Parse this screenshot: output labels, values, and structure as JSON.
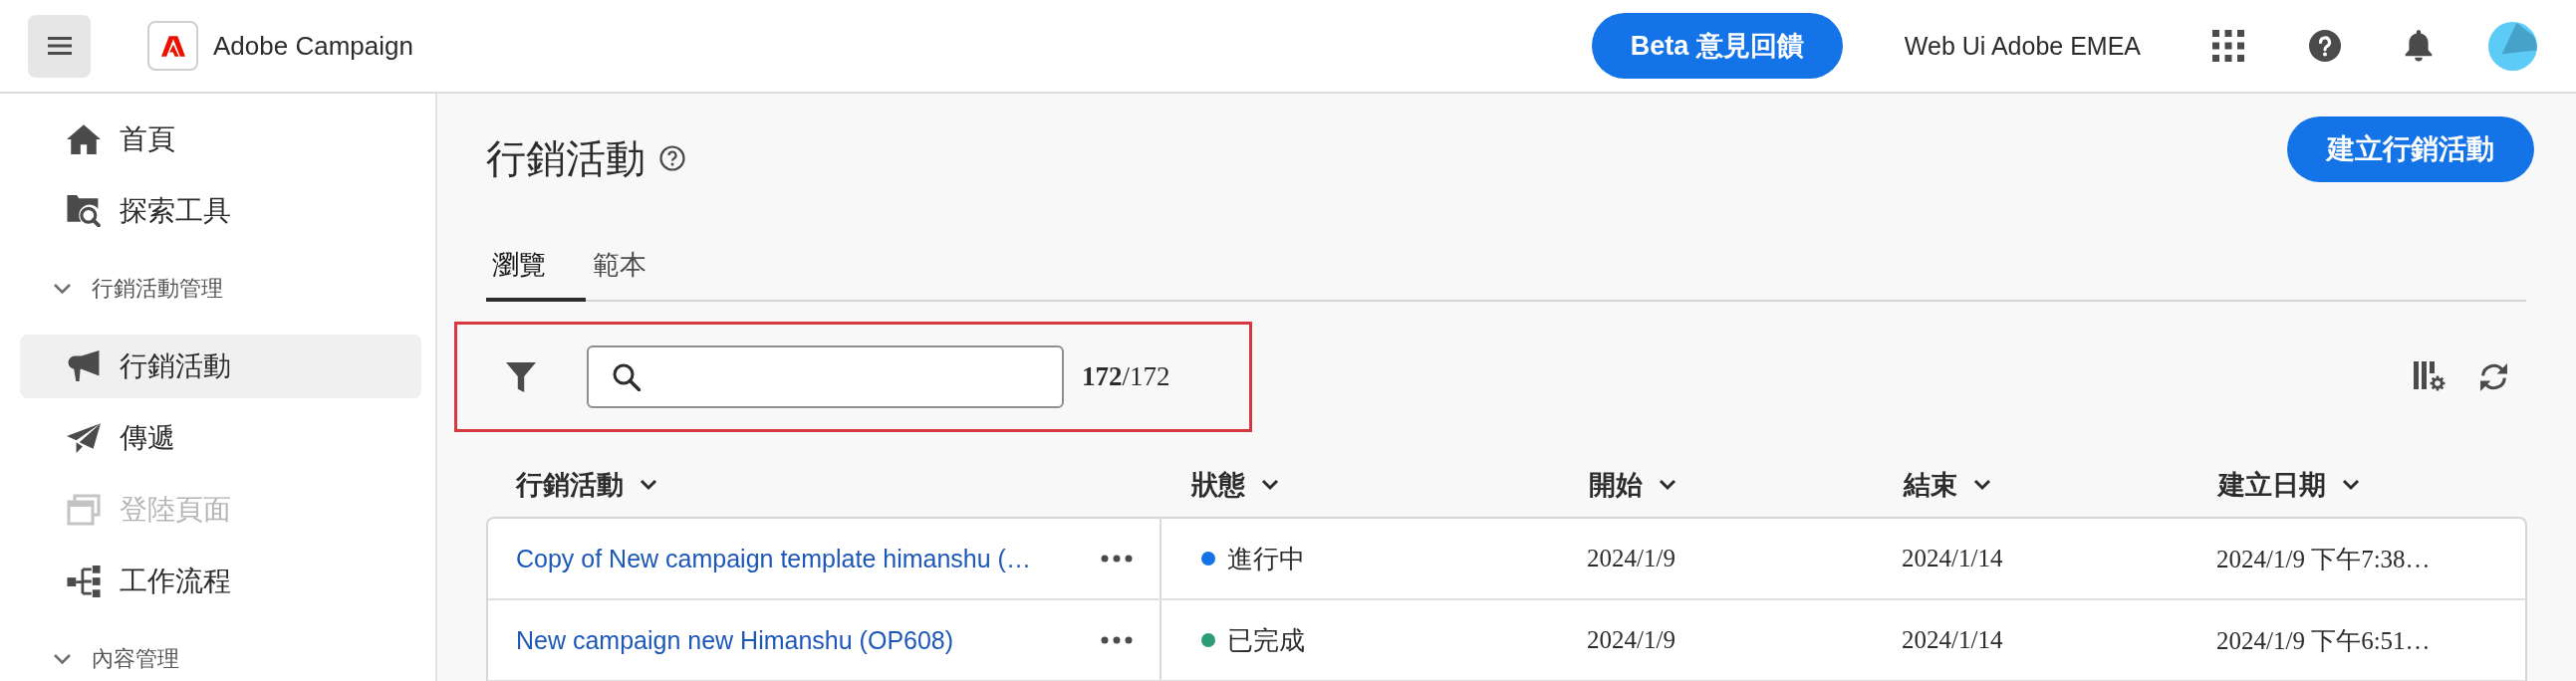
{
  "header": {
    "app_name": "Adobe Campaign",
    "feedback_button": "Beta 意見回饋",
    "organization": "Web Ui Adobe EMEA"
  },
  "sidebar": {
    "sections": [
      {
        "items": [
          {
            "label": "首頁",
            "selected": false,
            "disabled": false
          },
          {
            "label": "探索工具",
            "selected": false,
            "disabled": false
          }
        ]
      },
      {
        "title": "行銷活動管理",
        "expanded": true,
        "items": [
          {
            "label": "行銷活動",
            "selected": true,
            "disabled": false
          },
          {
            "label": "傳遞",
            "selected": false,
            "disabled": false
          },
          {
            "label": "登陸頁面",
            "selected": false,
            "disabled": true
          },
          {
            "label": "工作流程",
            "selected": false,
            "disabled": false
          }
        ]
      },
      {
        "title": "內容管理",
        "expanded": true
      }
    ]
  },
  "page": {
    "title": "行銷活動",
    "create_button": "建立行銷活動"
  },
  "tabs": [
    {
      "label": "瀏覽",
      "selected": true
    },
    {
      "label": "範本",
      "selected": false
    }
  ],
  "toolbar": {
    "highlighted": true,
    "count": "**172**/172"
  },
  "table": {
    "columns": [
      "行銷活動",
      "狀態",
      "開始",
      "結束",
      "建立日期"
    ],
    "rows": [
      {
        "name": "Copy of New campaign template himanshu (…",
        "status": "進行中",
        "color": "#1473e6",
        "start": "2024/1/9",
        "end": "2024/1/14",
        "created": "2024/1/9 下午7:38…"
      },
      {
        "name": "New campaign new Himanshu (OP608)",
        "status": "已完成",
        "color": "#2d9d78",
        "start": "2024/1/9",
        "end": "2024/1/14",
        "created": "2024/1/9 下午6:51…"
      }
    ]
  }
}
